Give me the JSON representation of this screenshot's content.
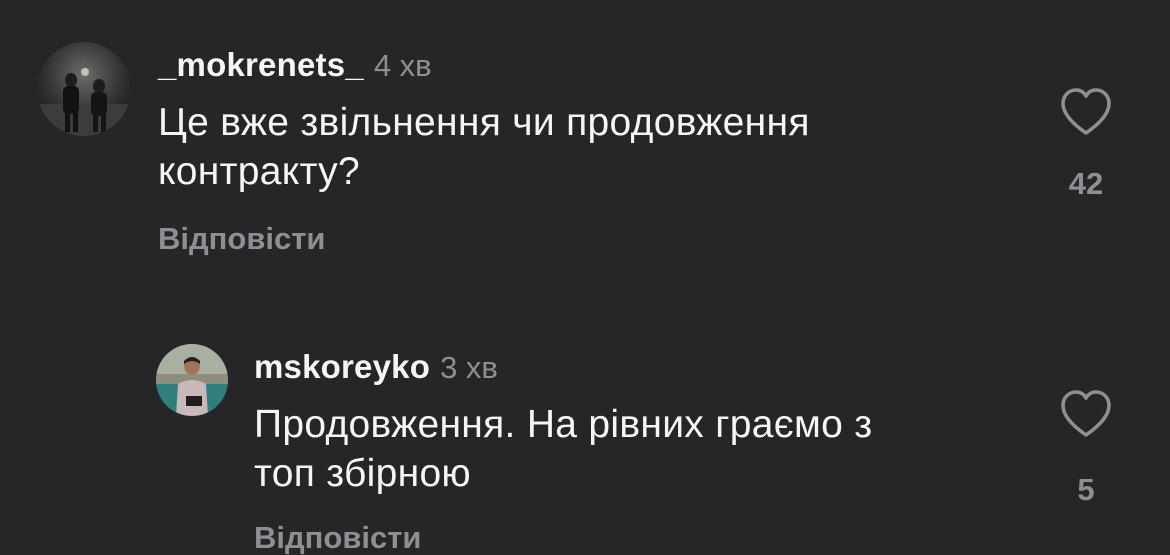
{
  "comments": [
    {
      "username": "_mokrenets_",
      "time": "4 хв",
      "text_line1": "Це вже звільнення чи продовження",
      "text_line2": "контракту?",
      "likes": "42",
      "reply_label": "Відповісти"
    },
    {
      "username": "mskoreyko",
      "time": "3 хв",
      "text_line1": "Продовження. На рівних граємо з",
      "text_line2": "топ збірною",
      "likes": "5",
      "reply_label": "Відповісти"
    }
  ],
  "icons": {
    "like": "heart-outline-icon"
  },
  "colors": {
    "background": "#262629",
    "text": "#f5f5f5",
    "secondary": "#8e8e93"
  }
}
